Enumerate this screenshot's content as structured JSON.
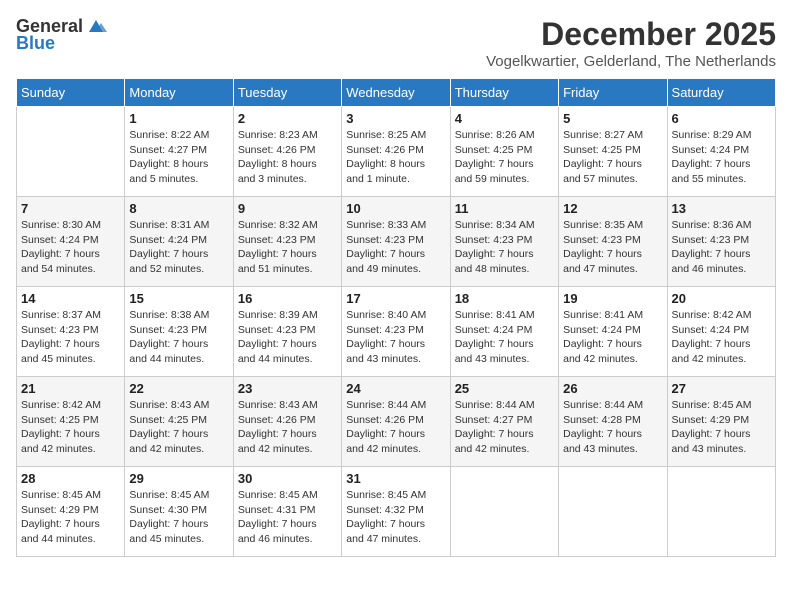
{
  "logo": {
    "general": "General",
    "blue": "Blue"
  },
  "title": "December 2025",
  "location": "Vogelkwartier, Gelderland, The Netherlands",
  "days_of_week": [
    "Sunday",
    "Monday",
    "Tuesday",
    "Wednesday",
    "Thursday",
    "Friday",
    "Saturday"
  ],
  "weeks": [
    [
      {
        "day": "",
        "info": ""
      },
      {
        "day": "1",
        "info": "Sunrise: 8:22 AM\nSunset: 4:27 PM\nDaylight: 8 hours\nand 5 minutes."
      },
      {
        "day": "2",
        "info": "Sunrise: 8:23 AM\nSunset: 4:26 PM\nDaylight: 8 hours\nand 3 minutes."
      },
      {
        "day": "3",
        "info": "Sunrise: 8:25 AM\nSunset: 4:26 PM\nDaylight: 8 hours\nand 1 minute."
      },
      {
        "day": "4",
        "info": "Sunrise: 8:26 AM\nSunset: 4:25 PM\nDaylight: 7 hours\nand 59 minutes."
      },
      {
        "day": "5",
        "info": "Sunrise: 8:27 AM\nSunset: 4:25 PM\nDaylight: 7 hours\nand 57 minutes."
      },
      {
        "day": "6",
        "info": "Sunrise: 8:29 AM\nSunset: 4:24 PM\nDaylight: 7 hours\nand 55 minutes."
      }
    ],
    [
      {
        "day": "7",
        "info": "Sunrise: 8:30 AM\nSunset: 4:24 PM\nDaylight: 7 hours\nand 54 minutes."
      },
      {
        "day": "8",
        "info": "Sunrise: 8:31 AM\nSunset: 4:24 PM\nDaylight: 7 hours\nand 52 minutes."
      },
      {
        "day": "9",
        "info": "Sunrise: 8:32 AM\nSunset: 4:23 PM\nDaylight: 7 hours\nand 51 minutes."
      },
      {
        "day": "10",
        "info": "Sunrise: 8:33 AM\nSunset: 4:23 PM\nDaylight: 7 hours\nand 49 minutes."
      },
      {
        "day": "11",
        "info": "Sunrise: 8:34 AM\nSunset: 4:23 PM\nDaylight: 7 hours\nand 48 minutes."
      },
      {
        "day": "12",
        "info": "Sunrise: 8:35 AM\nSunset: 4:23 PM\nDaylight: 7 hours\nand 47 minutes."
      },
      {
        "day": "13",
        "info": "Sunrise: 8:36 AM\nSunset: 4:23 PM\nDaylight: 7 hours\nand 46 minutes."
      }
    ],
    [
      {
        "day": "14",
        "info": "Sunrise: 8:37 AM\nSunset: 4:23 PM\nDaylight: 7 hours\nand 45 minutes."
      },
      {
        "day": "15",
        "info": "Sunrise: 8:38 AM\nSunset: 4:23 PM\nDaylight: 7 hours\nand 44 minutes."
      },
      {
        "day": "16",
        "info": "Sunrise: 8:39 AM\nSunset: 4:23 PM\nDaylight: 7 hours\nand 44 minutes."
      },
      {
        "day": "17",
        "info": "Sunrise: 8:40 AM\nSunset: 4:23 PM\nDaylight: 7 hours\nand 43 minutes."
      },
      {
        "day": "18",
        "info": "Sunrise: 8:41 AM\nSunset: 4:24 PM\nDaylight: 7 hours\nand 43 minutes."
      },
      {
        "day": "19",
        "info": "Sunrise: 8:41 AM\nSunset: 4:24 PM\nDaylight: 7 hours\nand 42 minutes."
      },
      {
        "day": "20",
        "info": "Sunrise: 8:42 AM\nSunset: 4:24 PM\nDaylight: 7 hours\nand 42 minutes."
      }
    ],
    [
      {
        "day": "21",
        "info": "Sunrise: 8:42 AM\nSunset: 4:25 PM\nDaylight: 7 hours\nand 42 minutes."
      },
      {
        "day": "22",
        "info": "Sunrise: 8:43 AM\nSunset: 4:25 PM\nDaylight: 7 hours\nand 42 minutes."
      },
      {
        "day": "23",
        "info": "Sunrise: 8:43 AM\nSunset: 4:26 PM\nDaylight: 7 hours\nand 42 minutes."
      },
      {
        "day": "24",
        "info": "Sunrise: 8:44 AM\nSunset: 4:26 PM\nDaylight: 7 hours\nand 42 minutes."
      },
      {
        "day": "25",
        "info": "Sunrise: 8:44 AM\nSunset: 4:27 PM\nDaylight: 7 hours\nand 42 minutes."
      },
      {
        "day": "26",
        "info": "Sunrise: 8:44 AM\nSunset: 4:28 PM\nDaylight: 7 hours\nand 43 minutes."
      },
      {
        "day": "27",
        "info": "Sunrise: 8:45 AM\nSunset: 4:29 PM\nDaylight: 7 hours\nand 43 minutes."
      }
    ],
    [
      {
        "day": "28",
        "info": "Sunrise: 8:45 AM\nSunset: 4:29 PM\nDaylight: 7 hours\nand 44 minutes."
      },
      {
        "day": "29",
        "info": "Sunrise: 8:45 AM\nSunset: 4:30 PM\nDaylight: 7 hours\nand 45 minutes."
      },
      {
        "day": "30",
        "info": "Sunrise: 8:45 AM\nSunset: 4:31 PM\nDaylight: 7 hours\nand 46 minutes."
      },
      {
        "day": "31",
        "info": "Sunrise: 8:45 AM\nSunset: 4:32 PM\nDaylight: 7 hours\nand 47 minutes."
      },
      {
        "day": "",
        "info": ""
      },
      {
        "day": "",
        "info": ""
      },
      {
        "day": "",
        "info": ""
      }
    ]
  ]
}
